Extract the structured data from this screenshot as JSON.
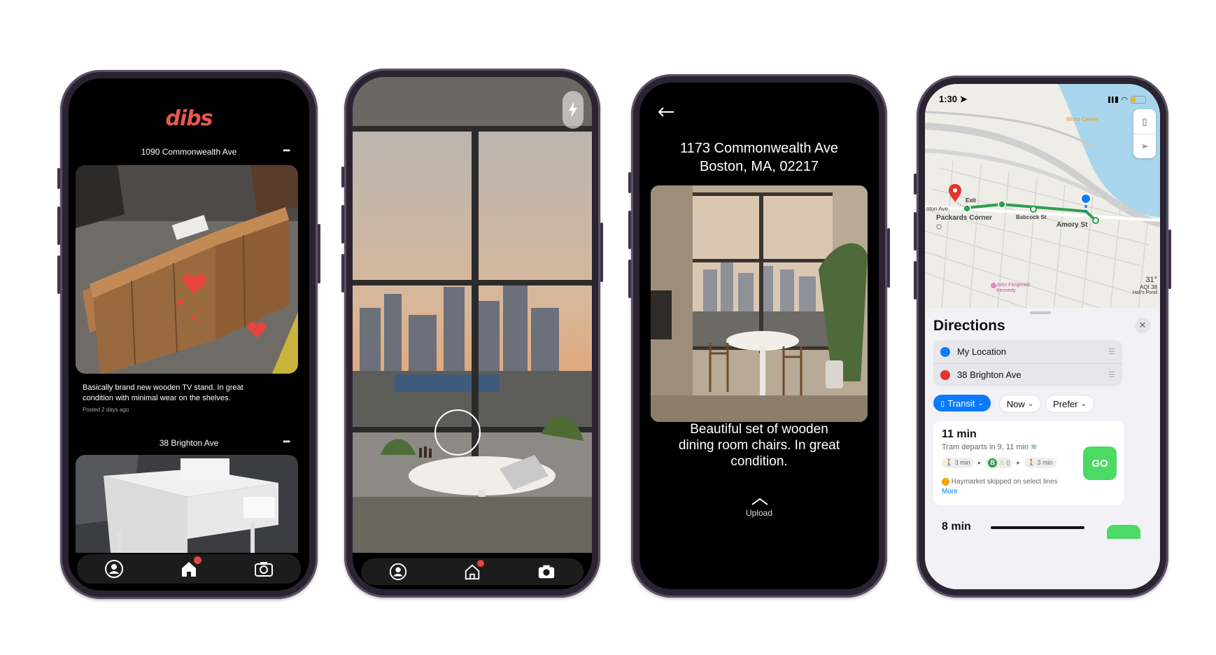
{
  "phone1": {
    "logo": "dibs",
    "post1": {
      "address": "1090 Commonwealth Ave",
      "menu": "•••",
      "description": "Basically brand new wooden TV stand. In great condition with minimal wear on the shelves.",
      "posted": "Posted 2 days ago"
    },
    "post2": {
      "address": "38 Brighton Ave",
      "menu": "•••"
    },
    "tabs": [
      "profile-icon",
      "home-icon",
      "camera-icon"
    ]
  },
  "phone2": {
    "flash_icon": "flash-icon",
    "shutter_icon": "shutter-button",
    "tabs": [
      "profile-icon",
      "home-icon",
      "camera-icon"
    ]
  },
  "phone3": {
    "back_icon": "back-arrow-icon",
    "address_line1": "1173 Commonwealth Ave",
    "address_line2": "Boston, MA, 02217",
    "description": "Beautiful set of wooden dining room chairs. In great condition.",
    "upload_label": "Upload"
  },
  "phone4": {
    "status": {
      "time": "1:30"
    },
    "map_labels": {
      "micro_center": "Micro Center",
      "exit": "Exit",
      "on_ave": "nton Ave",
      "packards": "Packards Corner",
      "babcock": "Babcock St",
      "amory": "Amory St",
      "kennedy": "John Fitzgerald Kennedy",
      "temp": "31°",
      "aqi": "AQI 38",
      "halls": "Hall's Pond"
    },
    "directions": {
      "title": "Directions",
      "from": "My Location",
      "to": "38 Brighton Ave",
      "mode": "Transit",
      "time": "Now",
      "prefer": "Prefer"
    },
    "route1": {
      "duration": "11 min",
      "departs": "Tram departs in 9, 11 min",
      "walk1": "3 min",
      "walk2": "3 min",
      "line": "B",
      "warning": "Haymarket skipped on select lines",
      "more": "More",
      "go": "GO"
    },
    "route2": {
      "duration": "8 min"
    }
  },
  "colors": {
    "dibs_red": "#e8584f",
    "ios_blue": "#0a7aff",
    "go_green": "#4cd964",
    "transit_green": "#2f9e4e"
  }
}
